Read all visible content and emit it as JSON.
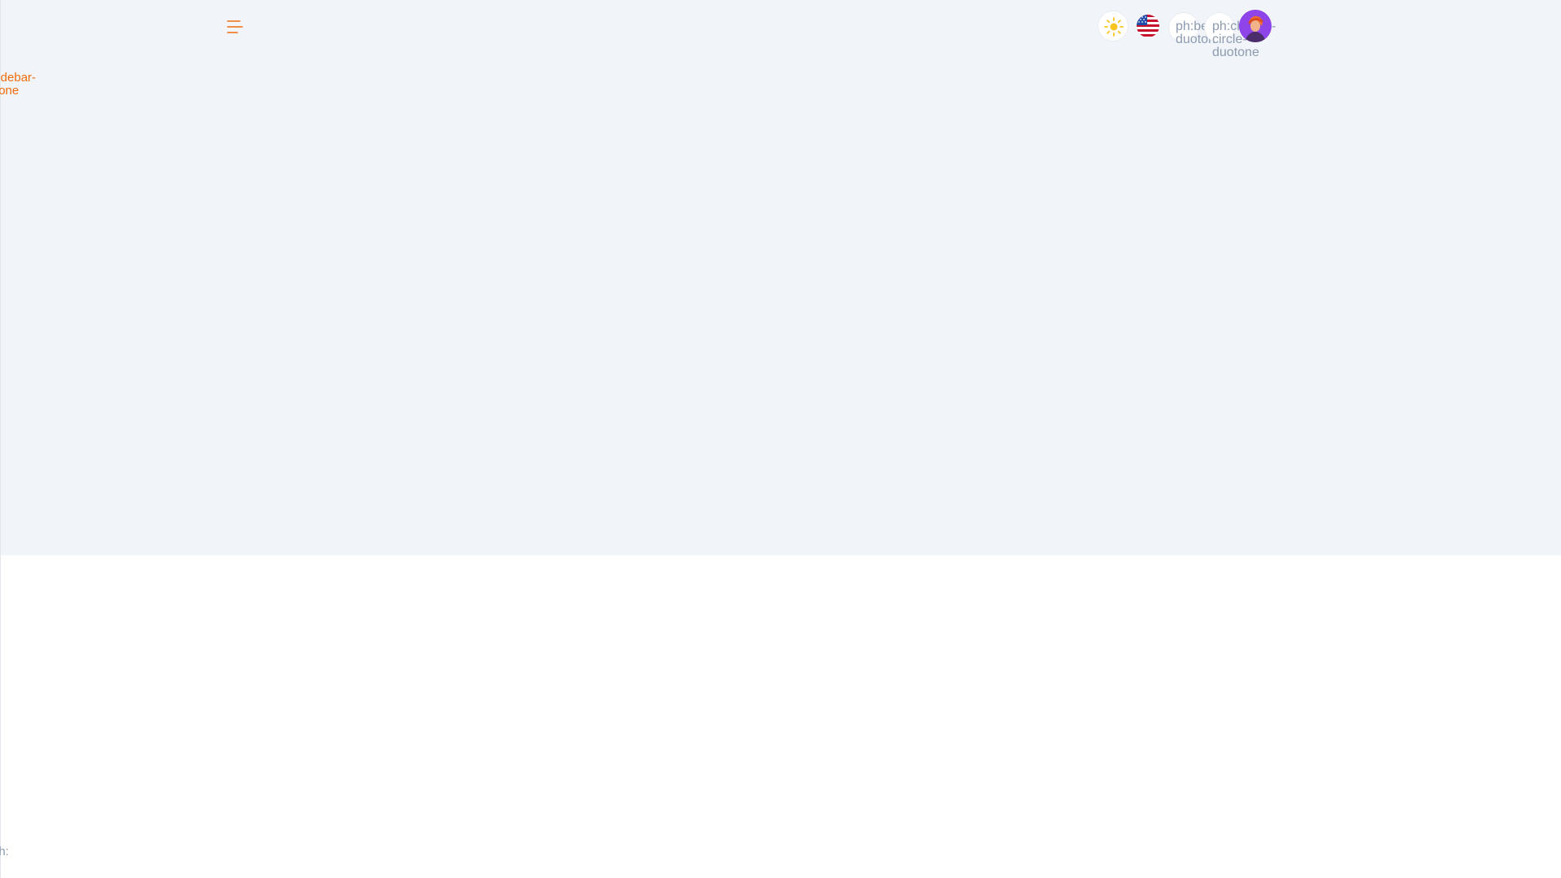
{
  "header": {
    "menu_icon": "hamburger-menu-icon",
    "theme_icon": "sun-icon",
    "language_icon": "us-flag-icon",
    "notification_icon_text": "ph:bell-\nduotone",
    "chat_icon_text": "ph:chat-\ncircle-\nduotone",
    "avatar_icon": "user-avatar-icon",
    "avatar_tail_text": "-"
  },
  "sidebar": {
    "broken_icon_text": "ph:sidebar-\nduotone"
  },
  "footer": {
    "broken_icon_text": "ph:\n"
  },
  "colors": {
    "page_background": "#f1f4f9",
    "main_background": "#ffffff",
    "accent": "#ef6c0f",
    "muted_text": "#8c9bb0",
    "avatar_background": "#8e44e8",
    "sun": "#f7c51d"
  }
}
